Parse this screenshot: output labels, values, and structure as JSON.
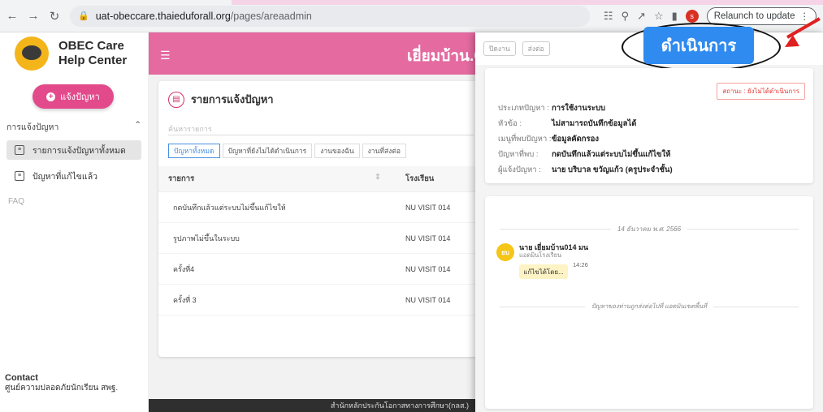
{
  "browser": {
    "url_host": "uat-obeccare.thaieduforall.org",
    "url_path": "/pages/areaadmin",
    "relaunch_label": "Relaunch to update",
    "profile_initial": "s"
  },
  "sidebar": {
    "logo_line1": "OBEC Care",
    "logo_line2": "Help Center",
    "report_button": "แจ้งปัญหา",
    "section_label": "การแจ้งปัญหา",
    "items": [
      {
        "label": "รายการแจ้งปัญหาทั้งหมด"
      },
      {
        "label": "ปัญหาที่แก้ไขแล้ว"
      }
    ],
    "faq": "FAQ",
    "contact_title": "Contact",
    "contact_sub": "ศูนย์ความปลอดภัยนักเรียน สพฐ."
  },
  "header": {
    "title": "เยี่ยมบ้าน.O"
  },
  "list": {
    "title": "รายการแจ้งปัญหา",
    "search_placeholder": "ค้นหารายการ",
    "tabs": [
      "ปัญหาทั้งหมด",
      "ปัญหาที่ยังไม่ได้ดำเนินการ",
      "งานของฉัน",
      "งานที่ส่งต่อ"
    ],
    "col_item": "รายการ",
    "col_school": "โรงเรียน",
    "rows": [
      {
        "item": "กดบันทึกแล้วแต่ระบบไม่ขึ้นแก้ไขให้",
        "school": "NU VISIT 014"
      },
      {
        "item": "รูปภาพไม่ขึ้นในระบบ",
        "school": "NU VISIT 014"
      },
      {
        "item": "ครั้งที่4",
        "school": "NU VISIT 014"
      },
      {
        "item": "ครั้งที่ 3",
        "school": "NU VISIT 014"
      }
    ]
  },
  "footer": {
    "text": "สำนักหลักประกันโอกาสทางการศึกษา(กลส.)"
  },
  "panel": {
    "btn_work": "ปิดงาน",
    "btn_forward": "ส่งต่อ",
    "proceed_button": "ดำเนินการ",
    "status": "สถานะ : ยังไม่ได้ดำเนินการ",
    "fields": [
      {
        "label": "ประเภทปัญหา :",
        "value": "การใช้งานระบบ"
      },
      {
        "label": "หัวข้อ :",
        "value": "ไม่สามารถบันทึกข้อมูลได้"
      },
      {
        "label": "เมนูที่พบปัญหา :",
        "value": "ข้อมูลคัดกรอง"
      },
      {
        "label": "ปัญหาที่พบ :",
        "value": "กดบันทึกแล้วแต่ระบบไม่ขึ้นแก้ไขให้"
      },
      {
        "label": "ผู้แจ้งปัญหา :",
        "value": "นาย บริบาล ขวัญแก้ว (ครูประจำชั้น)"
      }
    ],
    "date_sep": "14 ธันวาคม พ.ศ. 2566",
    "avatar_initials": "ยบ",
    "sender": "นาย เยี่ยมบ้าน014 มน",
    "sender_role": "แอดมินโรงเรียน",
    "bubble": "แก้ไขได้โดย...",
    "msg_time": "14:26",
    "sys_sep": "ปัญหาของท่านถูกส่งต่อไปที่ แอดมินเขตพื้นที่"
  }
}
